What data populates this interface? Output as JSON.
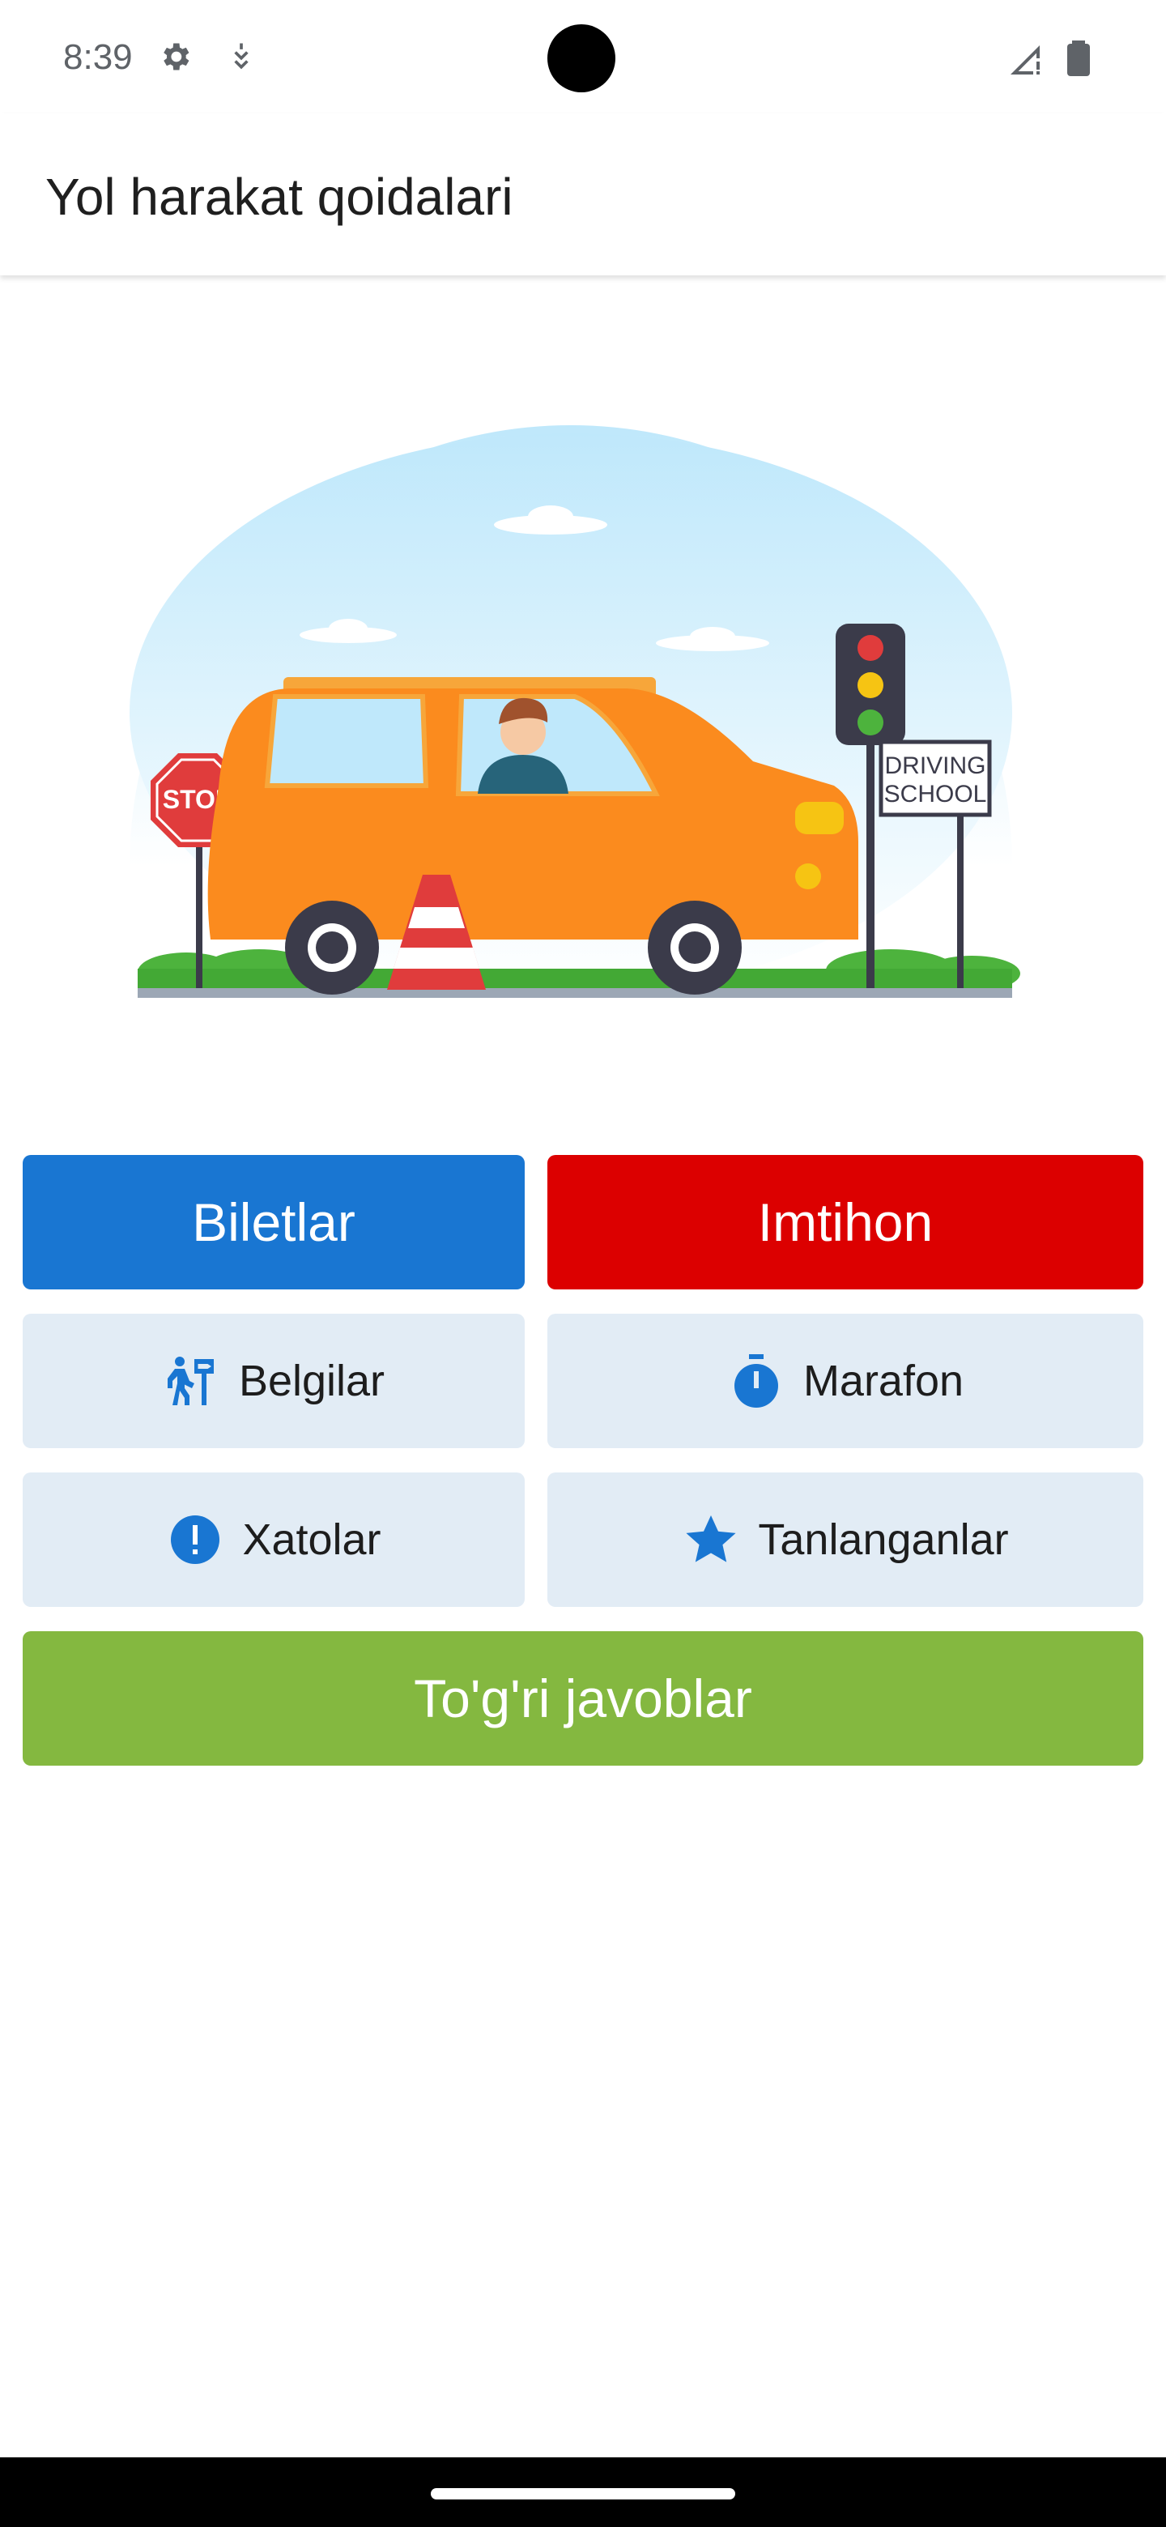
{
  "status_bar": {
    "time": "8:39",
    "icons_left": [
      "settings-icon",
      "usb-debug-icon"
    ],
    "icons_right": [
      "signal-icon",
      "battery-icon"
    ]
  },
  "app_bar": {
    "title": "Yol harakat qoidalari"
  },
  "hero": {
    "description_icons": [
      "car",
      "stop-sign",
      "traffic-light",
      "traffic-cone"
    ],
    "stop_sign_text": "STOP",
    "sign_text_line1": "DRIVING",
    "sign_text_line2": "SCHOOL"
  },
  "buttons": {
    "biletlar": "Biletlar",
    "imtihon": "Imtihon",
    "belgilar": "Belgilar",
    "marafon": "Marafon",
    "xatolar": "Xatolar",
    "tanlanganlar": "Tanlanganlar",
    "togri_javoblar": "To'g'ri javoblar"
  },
  "colors": {
    "blue": "#1976d2",
    "red": "#dc0000",
    "green": "#84b840",
    "light_blue_bg": "#e2ecf5",
    "icon_blue": "#1976d2"
  }
}
